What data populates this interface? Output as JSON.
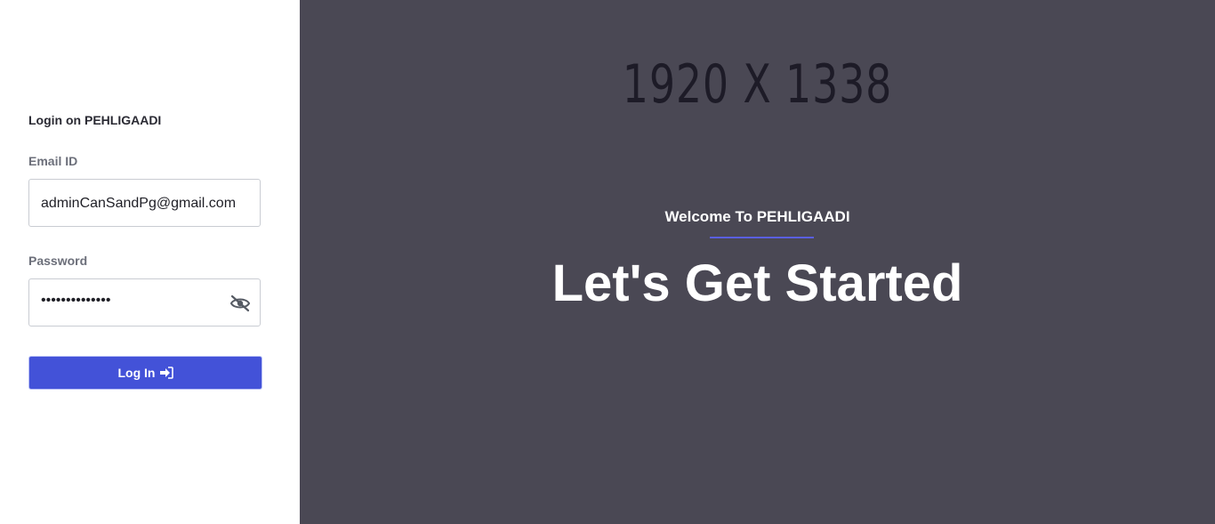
{
  "login": {
    "title": "Login on PEHLIGAADI",
    "email_label": "Email ID",
    "email_value": "adminCanSandPg@gmail.com",
    "password_label": "Password",
    "password_value": "••••••••••••••",
    "submit_label": "Log In",
    "icons": {
      "toggle_visibility": "eye-slash-icon",
      "submit": "sign-in-icon"
    },
    "accent_color": "#4352d8"
  },
  "hero": {
    "placeholder_text": "1920 X 1338",
    "welcome_text": "Welcome To PEHLIGAADI",
    "headline": "Let's Get Started",
    "background_color": "#4a4854"
  }
}
